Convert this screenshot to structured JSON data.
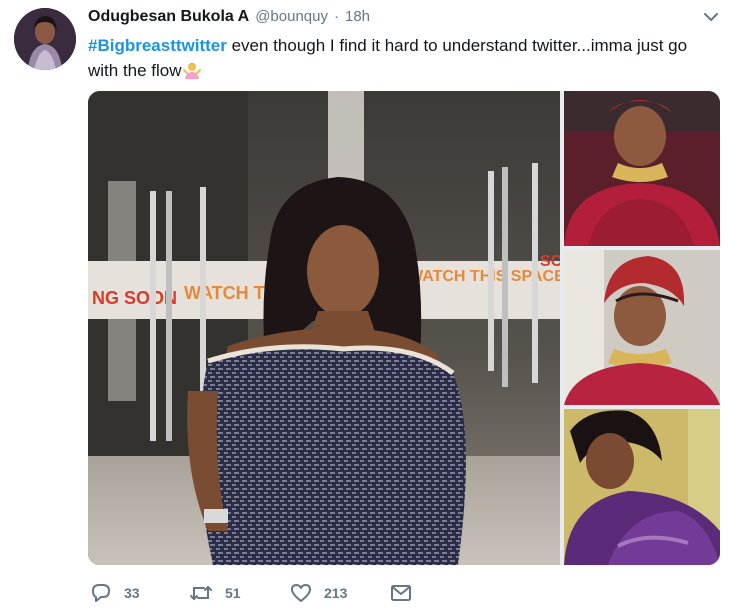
{
  "tweet": {
    "author_name": "Odugbesan Bukola A",
    "handle": "@bounquy",
    "separator": "·",
    "time": "18h",
    "hashtag": "#Bigbreasttwitter",
    "text": " even though I find it hard to understand twitter...imma just go with the flow",
    "emoji_icon": "person-shrugging-emoji"
  },
  "media": {
    "banner_left_text": "NG SOON",
    "banner_mid_text": "WATCH THIS",
    "banner_right_text": "WATCH THIS SPACE",
    "banner_far_right_text": "SO"
  },
  "actions": {
    "reply_count": "33",
    "retweet_count": "51",
    "like_count": "213"
  },
  "colors": {
    "link": "#1b95e0",
    "muted": "#657786",
    "text": "#14171a"
  }
}
